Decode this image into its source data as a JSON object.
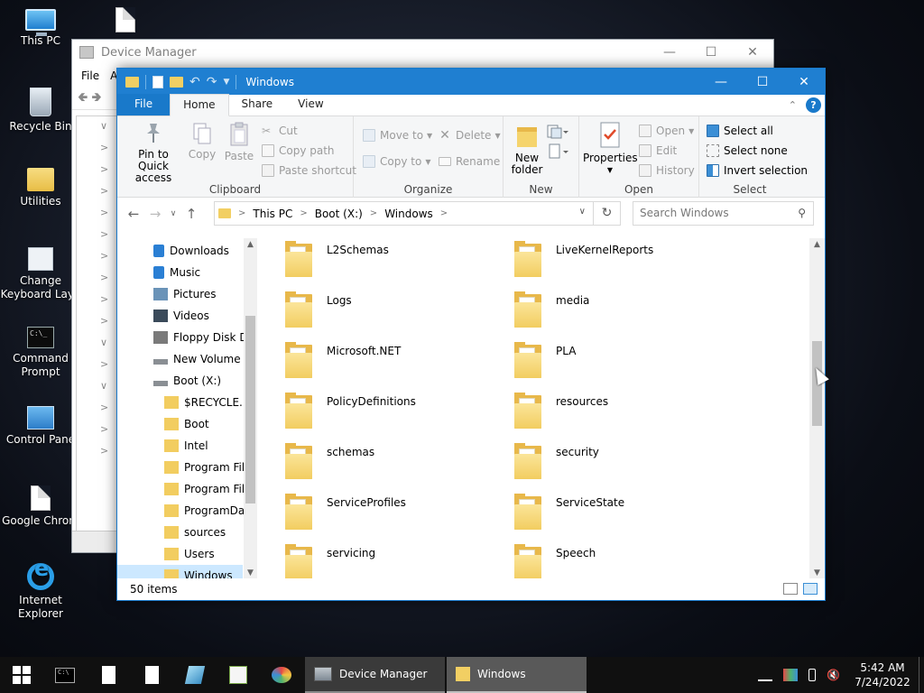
{
  "desktop": {
    "icons": [
      {
        "label": "This PC"
      },
      {
        "label": ""
      },
      {
        "label": "Recycle Bin"
      },
      {
        "label": "Utilities"
      },
      {
        "label": "Change Keyboard Layo"
      },
      {
        "label": "Command Prompt"
      },
      {
        "label": "Control Pane"
      },
      {
        "label": "Google Chrom"
      },
      {
        "label": "Internet Explorer"
      }
    ]
  },
  "device_manager": {
    "title": "Device Manager",
    "menu": [
      "File",
      "A"
    ]
  },
  "explorer": {
    "title": "Windows",
    "ribbon_tabs": [
      "File",
      "Home",
      "Share",
      "View"
    ],
    "ribbon": {
      "clipboard": {
        "label": "Clipboard",
        "pin": "Pin to Quick access",
        "copy": "Copy",
        "paste": "Paste",
        "cut": "Cut",
        "copy_path": "Copy path",
        "paste_shortcut": "Paste shortcut"
      },
      "organize": {
        "label": "Organize",
        "move_to": "Move to",
        "copy_to": "Copy to",
        "delete": "Delete",
        "rename": "Rename"
      },
      "new": {
        "label": "New",
        "new_folder": "New folder"
      },
      "open": {
        "label": "Open",
        "properties": "Properties",
        "open": "Open",
        "edit": "Edit",
        "history": "History"
      },
      "select": {
        "label": "Select",
        "select_all": "Select all",
        "select_none": "Select none",
        "invert": "Invert selection"
      }
    },
    "address": {
      "crumbs": [
        "This PC",
        "Boot (X:)",
        "Windows"
      ]
    },
    "search": {
      "placeholder": "Search Windows"
    },
    "nav_pane": [
      {
        "label": "Downloads",
        "icon": "downloads-icon"
      },
      {
        "label": "Music",
        "icon": "music-icon"
      },
      {
        "label": "Pictures",
        "icon": "pictures-icon"
      },
      {
        "label": "Videos",
        "icon": "videos-icon"
      },
      {
        "label": "Floppy Disk Dri",
        "icon": "floppy-icon"
      },
      {
        "label": "New Volume (C",
        "icon": "drive-icon"
      },
      {
        "label": "Boot (X:)",
        "icon": "drive-icon"
      },
      {
        "label": "$RECYCLE.BIN",
        "icon": "folder-icon"
      },
      {
        "label": "Boot",
        "icon": "folder-icon"
      },
      {
        "label": "Intel",
        "icon": "folder-icon"
      },
      {
        "label": "Program Files",
        "icon": "folder-icon"
      },
      {
        "label": "Program Files",
        "icon": "folder-icon"
      },
      {
        "label": "ProgramData",
        "icon": "folder-icon"
      },
      {
        "label": "sources",
        "icon": "folder-icon"
      },
      {
        "label": "Users",
        "icon": "folder-icon"
      },
      {
        "label": "Windows",
        "icon": "folder-icon"
      }
    ],
    "files": [
      {
        "name": "L2Schemas"
      },
      {
        "name": "LiveKernelReports"
      },
      {
        "name": "Logs"
      },
      {
        "name": "media"
      },
      {
        "name": "Microsoft.NET"
      },
      {
        "name": "PLA"
      },
      {
        "name": "PolicyDefinitions"
      },
      {
        "name": "resources"
      },
      {
        "name": "schemas"
      },
      {
        "name": "security"
      },
      {
        "name": "ServiceProfiles"
      },
      {
        "name": "ServiceState"
      },
      {
        "name": "servicing"
      },
      {
        "name": "Speech"
      }
    ],
    "status": {
      "item_count": "50 items"
    }
  },
  "taskbar": {
    "tasks": [
      {
        "label": "Device Manager"
      },
      {
        "label": "Windows"
      }
    ],
    "clock": {
      "time": "5:42 AM",
      "date": "7/24/2022"
    }
  },
  "colors": {
    "accent": "#1f7fd1",
    "folder": "#f2cd60",
    "selection": "#cce8ff"
  }
}
